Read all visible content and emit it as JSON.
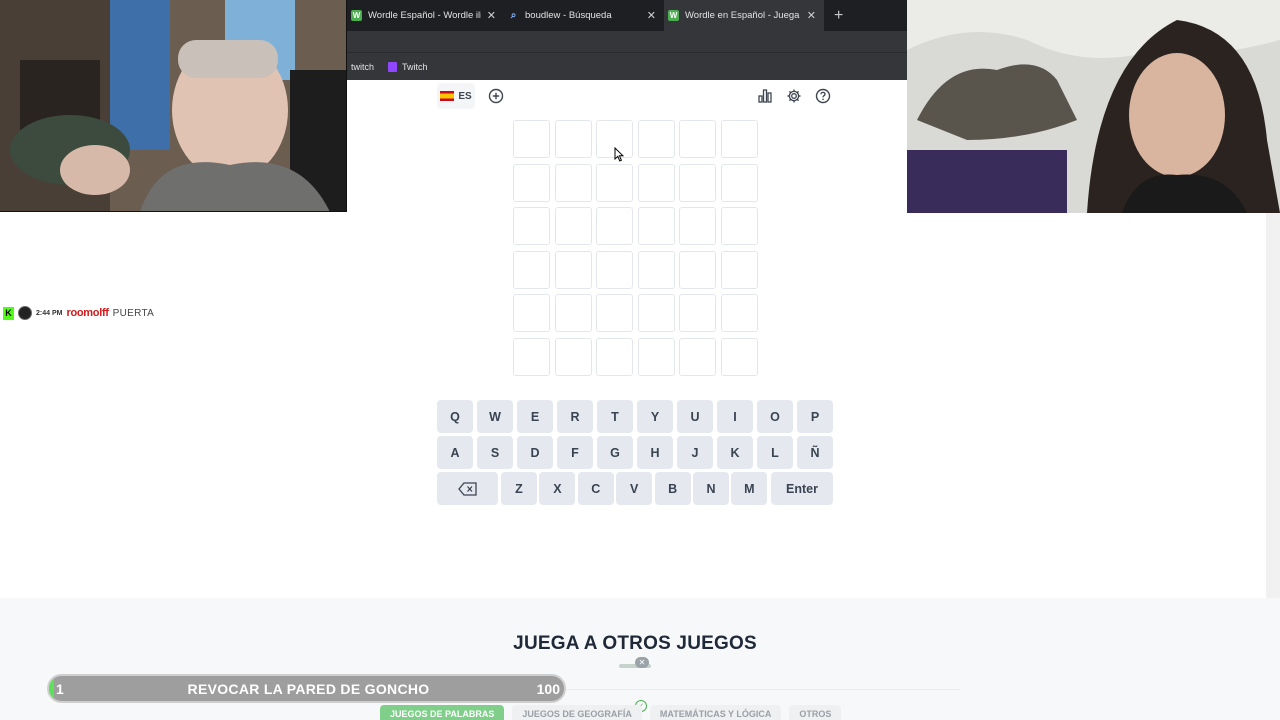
{
  "browser": {
    "tabs": [
      {
        "title": "Wordle Español - Wordle ilimitado",
        "favicon": "wordle-favicon",
        "active": false
      },
      {
        "title": "boudlew - Búsqueda",
        "favicon": "search-favicon",
        "active": false
      },
      {
        "title": "Wordle en Español - Juega Wordle",
        "favicon": "wordle-favicon",
        "active": true
      }
    ],
    "bookmarks": [
      "twitch",
      "Twitch"
    ]
  },
  "toolbar": {
    "language_label": "ES",
    "icons": [
      "add-icon",
      "stats-icon",
      "settings-icon",
      "help-icon"
    ]
  },
  "board": {
    "rows": 6,
    "columns": 6,
    "letters": []
  },
  "keyboard": {
    "row1": [
      "Q",
      "W",
      "E",
      "R",
      "T",
      "Y",
      "U",
      "I",
      "O",
      "P"
    ],
    "row2": [
      "A",
      "S",
      "D",
      "F",
      "G",
      "H",
      "J",
      "K",
      "L",
      "Ñ"
    ],
    "row3": [
      "Z",
      "X",
      "C",
      "V",
      "B",
      "N",
      "M"
    ],
    "enter_label": "Enter",
    "backspace_icon": "backspace-icon"
  },
  "footer": {
    "other_games_title": "JUEGA A OTROS JUEGOS",
    "games": [
      "JUEGOS DE PALABRAS",
      "JUEGOS DE GEOGRAFÍA",
      "MATEMÁTICAS Y LÓGICA",
      "OTROS"
    ]
  },
  "chat": {
    "time": "2:44 PM",
    "user": "roomolff",
    "message": "PUERTA"
  },
  "redeem": {
    "count": "1",
    "title": "REVOCAR LA PARED DE GONCHO",
    "cost": "100",
    "progress_fraction": 0.01
  },
  "colors": {
    "accent_green": "#4caf50",
    "key_bg": "#e5e9ef",
    "tile_border": "#e3e7ec",
    "chat_user": "#d11a1a"
  }
}
